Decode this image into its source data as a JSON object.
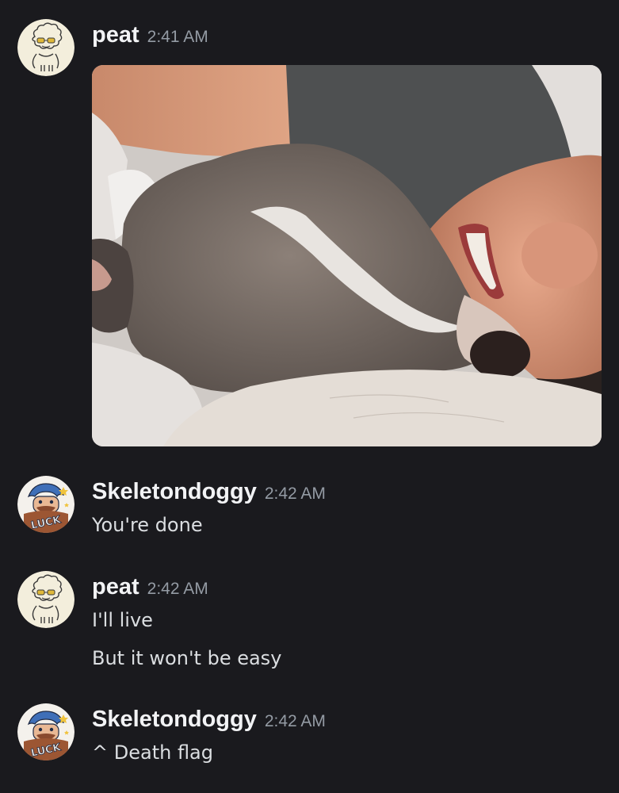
{
  "messages": [
    {
      "author": "peat",
      "time": "2:41 AM",
      "avatar_icon": "sheep-doodle-avatar",
      "attachment": "photo of a sleeping grey and white dog cuddled against a smiling person"
    },
    {
      "author": "Skeletondoggy",
      "time": "2:42 AM",
      "avatar_icon": "luck-cartoon-avatar",
      "lines": [
        "You're done"
      ]
    },
    {
      "author": "peat",
      "time": "2:42 AM",
      "avatar_icon": "sheep-doodle-avatar",
      "lines": [
        "I'll live",
        "But it won't be easy"
      ]
    },
    {
      "author": "Skeletondoggy",
      "time": "2:42 AM",
      "avatar_icon": "luck-cartoon-avatar",
      "lines": [
        "^ Death flag"
      ]
    }
  ],
  "avatar_text": "LUCK",
  "colors": {
    "background": "#1a1a1e",
    "username": "#f2f3f5",
    "timestamp": "#949ba4",
    "message_text": "#dbdee1"
  }
}
